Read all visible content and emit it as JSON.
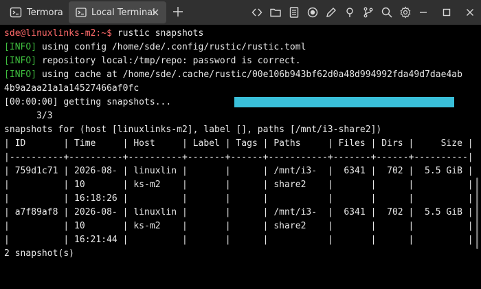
{
  "tabs": [
    {
      "label": "Termora",
      "icon": "terminal-app-icon",
      "active": false
    },
    {
      "label": "Local Terminal",
      "icon": "terminal-icon",
      "active": true
    }
  ],
  "toolbar_icons": [
    "code-icon",
    "folder-icon",
    "document-icon",
    "record-icon",
    "pen-icon",
    "bulb-icon",
    "git-branch-icon",
    "search-icon",
    "gear-icon"
  ],
  "window_controls": [
    "minimize-icon",
    "maximize-icon",
    "close-icon"
  ],
  "terminal": {
    "prompt": "sde@linuxlinks-m2:~$",
    "command": " rustic snapshots",
    "info_lines": [
      {
        "tag": "[INFO]",
        "text": " using config /home/sde/.config/rustic/rustic.toml"
      },
      {
        "tag": "[INFO]",
        "text": " repository local:/tmp/repo: password is correct."
      },
      {
        "tag": "[INFO]",
        "text": " using cache at /home/sde/.cache/rustic/00e106b943bf62d0a48d994992fda49d7dae4ab"
      }
    ],
    "cache_cont": "4b9a2aa21a1a14527466af0fc",
    "progress_text": "[00:00:00] getting snapshots...",
    "progress_count": "      3/3",
    "progress_fraction": 1.0,
    "snapshots_header": "snapshots for (host [linuxlinks-m2], label [], paths [/mnt/i3-share2])",
    "table_lines": [
      "| ID       | Time     | Host     | Label | Tags | Paths     | Files | Dirs |     Size |",
      "|----------+----------+----------+-------+------+-----------+-------+------+----------|",
      "| 759d1c71 | 2026-08- | linuxlin |       |      | /mnt/i3-  |  6341 |  702 |  5.5 GiB |",
      "|          | 10       | ks-m2    |       |      | share2    |       |      |          |",
      "|          | 16:18:26 |          |       |      |           |       |      |          |",
      "| a7f89af8 | 2026-08- | linuxlin |       |      | /mnt/i3-  |  6341 |  702 |  5.5 GiB |",
      "|          | 10       | ks-m2    |       |      | share2    |       |      |          |",
      "|          | 16:21:44 |          |       |      |           |       |      |          |"
    ],
    "footer": "2 snapshot(s)"
  },
  "colors": {
    "background": "#000000",
    "titlebar": "#303030",
    "active_tab": "#484848",
    "prompt": "#ff6a6a",
    "info": "#3fbf3f",
    "progress": "#3ac0da",
    "text": "#e8e8e8"
  }
}
